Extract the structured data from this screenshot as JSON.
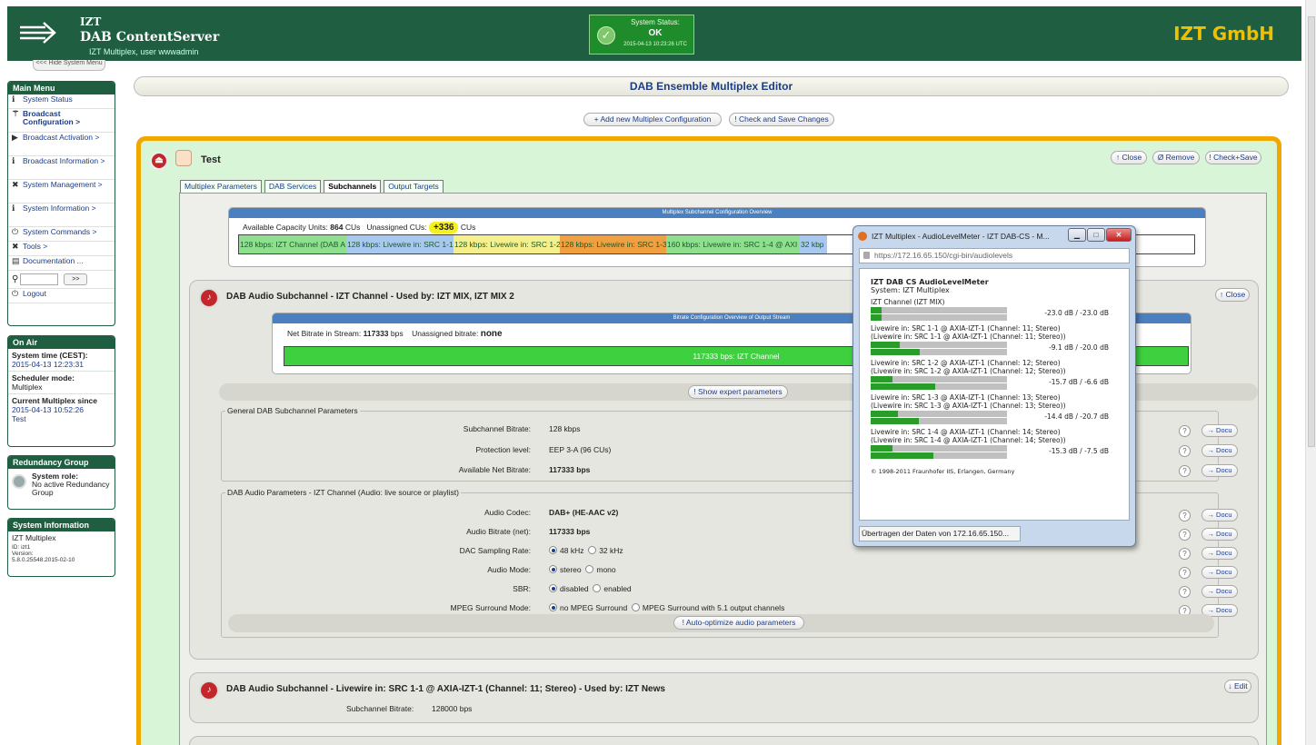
{
  "header": {
    "brand_line1": "IZT",
    "brand_line2": "DAB ContentServer",
    "brand_line3": "IZT Multiplex, user wwwadmin",
    "company": "IZT GmbH",
    "status": {
      "label": "System Status:",
      "value": "OK",
      "timestamp": "2015-04-13 10:23:26 UTC"
    }
  },
  "hide_menu": "<<< Hide System Menu",
  "main_menu": {
    "title": "Main Menu",
    "items": [
      {
        "label": "System Status",
        "icon": "info-icon"
      },
      {
        "label": "Broadcast Configuration >",
        "icon": "antenna-icon"
      },
      {
        "label": "Broadcast Activation >",
        "icon": "play-icon"
      },
      {
        "label": "Broadcast Information >",
        "icon": "info-icon"
      },
      {
        "label": "System Management >",
        "icon": "tools-icon"
      },
      {
        "label": "System Information >",
        "icon": "info-icon"
      },
      {
        "label": "System Commands >",
        "icon": "power-icon"
      },
      {
        "label": "Tools >",
        "icon": "tools-icon"
      },
      {
        "label": "Documentation ...",
        "icon": "book-icon"
      }
    ],
    "search_go": ">>",
    "logout": "Logout"
  },
  "on_air": {
    "title": "On Air",
    "time_label": "System time (CEST):",
    "time_value": "2015-04-13 12:23:31",
    "sched_label": "Scheduler mode:",
    "sched_value": "Multiplex",
    "current_label": "Current Multiplex since",
    "current_date": "2015-04-13 10:52:26",
    "current_name": "Test"
  },
  "redundancy": {
    "title": "Redundancy Group",
    "role_label": "System role:",
    "role_value": "No active Redundancy Group"
  },
  "sysinfo": {
    "title": "System Information",
    "name": "IZT Multiplex",
    "id": "ID: izt1",
    "version_label": "Version:",
    "version": "5.8.0.25548.2015-02-10"
  },
  "page": {
    "title": "DAB Ensemble Multiplex Editor",
    "add_btn": "+ Add new Multiplex Configuration",
    "check_btn": "! Check and Save Changes"
  },
  "mplex": {
    "name": "Test",
    "close": "↑ Close",
    "remove": "Ø Remove",
    "checksave": "! Check+Save",
    "tabs": [
      "Multiplex Parameters",
      "DAB Services",
      "Subchannels",
      "Output Targets"
    ]
  },
  "capacity": {
    "header": "Multiplex Subchannel Configuration Overview",
    "avail_label": "Available Capacity Units:",
    "avail_value": "864",
    "unit": "CUs",
    "unassigned_label": "Unassigned CUs:",
    "unassigned_value": "+336",
    "unassigned_unit": "CUs",
    "segments": [
      {
        "label": "128 kbps: IZT Channel (DAB A",
        "color": "#8ee08e"
      },
      {
        "label": "128 kbps: Livewire in: SRC 1-1",
        "color": "#a8c8f0"
      },
      {
        "label": "128 kbps: Livewire in: SRC 1-2",
        "color": "#f6f08c"
      },
      {
        "label": "128 kbps: Livewire in: SRC 1-3",
        "color": "#f0a040"
      },
      {
        "label": "160 kbps: Livewire in: SRC 1-4 @ AXI",
        "color": "#8ee08e"
      },
      {
        "label": "32 kbp",
        "color": "#a8c8f0"
      }
    ]
  },
  "sub1": {
    "title": "DAB Audio Subchannel - IZT Channel - Used by: IZT MIX, IZT MIX 2",
    "close": "↑ Close",
    "bitrate_header": "Bitrate Configuration Overview of Output Stream",
    "net_label": "Net Bitrate in Stream:",
    "net_value": "117333",
    "net_unit": "bps",
    "unassigned_label": "Unassigned bitrate:",
    "unassigned_value": "none",
    "bar_label": "117333 bps: IZT Channel",
    "expert_btn": "! Show expert parameters",
    "general_legend": "General DAB Subchannel Parameters",
    "general": [
      {
        "label": "Subchannel Bitrate:",
        "value": "128 kbps"
      },
      {
        "label": "Protection level:",
        "value": "EEP 3-A (96 CUs)"
      },
      {
        "label": "Available Net Bitrate:",
        "value": "117333 bps"
      }
    ],
    "audio_legend": "DAB Audio Parameters - IZT Channel (Audio: live source or playlist)",
    "codec_label": "Audio Codec:",
    "codec_value": "DAB+ (HE-AAC v2)",
    "abr_label": "Audio Bitrate (net):",
    "abr_value": "117333 bps",
    "dac_label": "DAC Sampling Rate:",
    "dac_opt1": "48 kHz",
    "dac_opt2": "32 kHz",
    "mode_label": "Audio Mode:",
    "mode_opt1": "stereo",
    "mode_opt2": "mono",
    "sbr_label": "SBR:",
    "sbr_opt1": "disabled",
    "sbr_opt2": "enabled",
    "mpeg_label": "MPEG Surround Mode:",
    "mpeg_opt1": "no MPEG Surround",
    "mpeg_opt2": "MPEG Surround with 5.1 output channels",
    "auto_btn": "! Auto-optimize audio parameters",
    "help": "?",
    "docu": "→ Docu"
  },
  "sub2": {
    "title": "DAB Audio Subchannel - Livewire in: SRC 1-1 @ AXIA-IZT-1 (Channel: 11; Stereo) - Used by: IZT News",
    "edit": "↓ Edit",
    "bitrate_label": "Subchannel Bitrate:",
    "bitrate_value": "128000 bps"
  },
  "popup": {
    "title": "IZT Multiplex - AudioLevelMeter - IZT DAB-CS - M...",
    "url": "https://172.16.65.150/cgi-bin/audiolevels",
    "heading": "IZT DAB CS AudioLevelMeter",
    "system": "System: IZT Multiplex",
    "channels": [
      {
        "name1": "IZT Channel (IZT MIX)",
        "name2": "",
        "db": "-23.0 dB / -23.0 dB",
        "left": 0.08,
        "right": 0.08
      },
      {
        "name1": "Livewire in: SRC 1-1 @ AXIA-IZT-1 (Channel: 11; Stereo)",
        "name2": "(Livewire in: SRC 1-1 @ AXIA-IZT-1 (Channel: 11; Stereo))",
        "db": "-9.1 dB / -20.0 dB",
        "left": 0.21,
        "right": 0.36
      },
      {
        "name1": "Livewire in: SRC 1-2 @ AXIA-IZT-1 (Channel: 12; Stereo)",
        "name2": "(Livewire in: SRC 1-2 @ AXIA-IZT-1 (Channel: 12; Stereo))",
        "db": "-15.7 dB / -6.6 dB",
        "left": 0.16,
        "right": 0.47
      },
      {
        "name1": "Livewire in: SRC 1-3 @ AXIA-IZT-1 (Channel: 13; Stereo)",
        "name2": "(Livewire in: SRC 1-3 @ AXIA-IZT-1 (Channel: 13; Stereo))",
        "db": "-14.4 dB / -20.7 dB",
        "left": 0.2,
        "right": 0.35
      },
      {
        "name1": "Livewire in: SRC 1-4 @ AXIA-IZT-1 (Channel: 14; Stereo)",
        "name2": "(Livewire in: SRC 1-4 @ AXIA-IZT-1 (Channel: 14; Stereo))",
        "db": "-15.3 dB / -7.5 dB",
        "left": 0.16,
        "right": 0.46
      }
    ],
    "copyright": "© 1998-2011 Fraunhofer IIS, Erlangen, Germany",
    "status": "Übertragen der Daten von 172.16.65.150..."
  }
}
